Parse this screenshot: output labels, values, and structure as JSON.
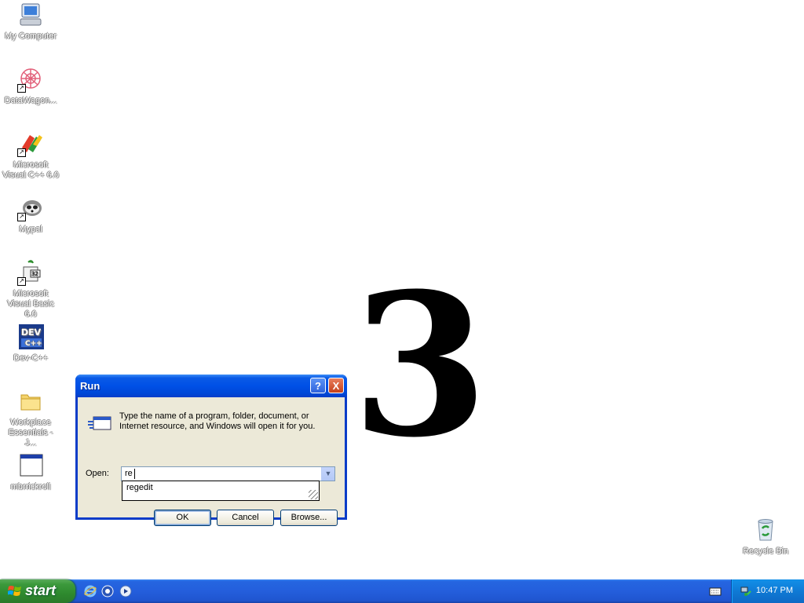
{
  "desktop": {
    "icons": [
      {
        "label": "My Computer",
        "icon": "my-computer-icon"
      },
      {
        "label": "DataWagon...",
        "icon": "datawagon-icon"
      },
      {
        "label": "Microsoft Visual C++ 6.0",
        "icon": "visual-cpp-icon"
      },
      {
        "label": "Mypal",
        "icon": "mypal-icon"
      },
      {
        "label": "Microsoft Visual Basic 6.0",
        "icon": "visual-basic-icon"
      },
      {
        "label": "Dev-C++",
        "icon": "dev-cpp-icon"
      },
      {
        "label": "Workplace Essentials - J...",
        "icon": "folder-icon"
      },
      {
        "label": "mbrrickroll",
        "icon": "window-app-icon"
      }
    ],
    "recycle_bin": {
      "label": "Recycle Bin",
      "icon": "recycle-bin-icon"
    },
    "big_text": "3"
  },
  "run_dialog": {
    "title": "Run",
    "description": "Type the name of a program, folder, document, or Internet resource, and Windows will open it for you.",
    "open_label": "Open:",
    "open_value": "re",
    "autocomplete": [
      "regedit"
    ],
    "ok_label": "OK",
    "cancel_label": "Cancel",
    "browse_label": "Browse...",
    "help_icon": "?",
    "close_icon": "X"
  },
  "taskbar": {
    "start_label": "start",
    "quick_launch": [
      "internet-explorer-icon",
      "mozilla-icon",
      "media-player-icon"
    ],
    "clock": "10:47 PM"
  }
}
